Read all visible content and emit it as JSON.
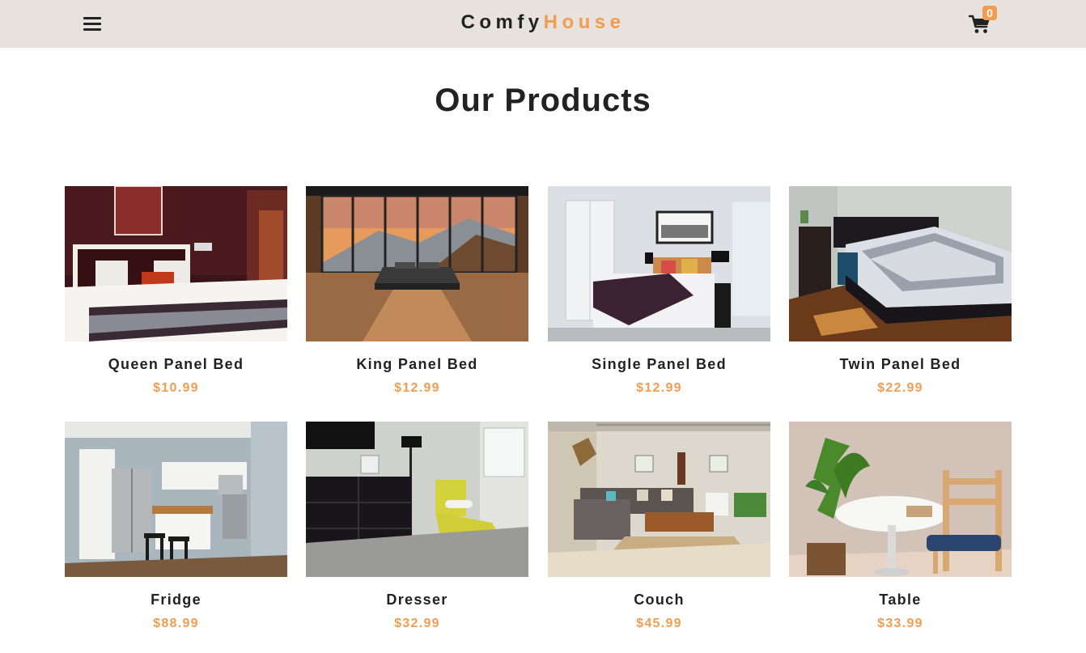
{
  "header": {
    "logo_part1": "Comfy",
    "logo_part2": "House",
    "cart_count": "0",
    "menu_icon": "bars-icon",
    "cart_icon": "cart-icon"
  },
  "section_title": "Our Products",
  "colors": {
    "accent": "#f09d51",
    "navbar_bg": "#e7e2dd",
    "text": "#222222"
  },
  "products": [
    {
      "name": "Queen Panel Bed",
      "price": "$10.99"
    },
    {
      "name": "King Panel Bed",
      "price": "$12.99"
    },
    {
      "name": "Single Panel Bed",
      "price": "$12.99"
    },
    {
      "name": "Twin Panel Bed",
      "price": "$22.99"
    },
    {
      "name": "Fridge",
      "price": "$88.99"
    },
    {
      "name": "Dresser",
      "price": "$32.99"
    },
    {
      "name": "Couch",
      "price": "$45.99"
    },
    {
      "name": "Table",
      "price": "$33.99"
    }
  ]
}
